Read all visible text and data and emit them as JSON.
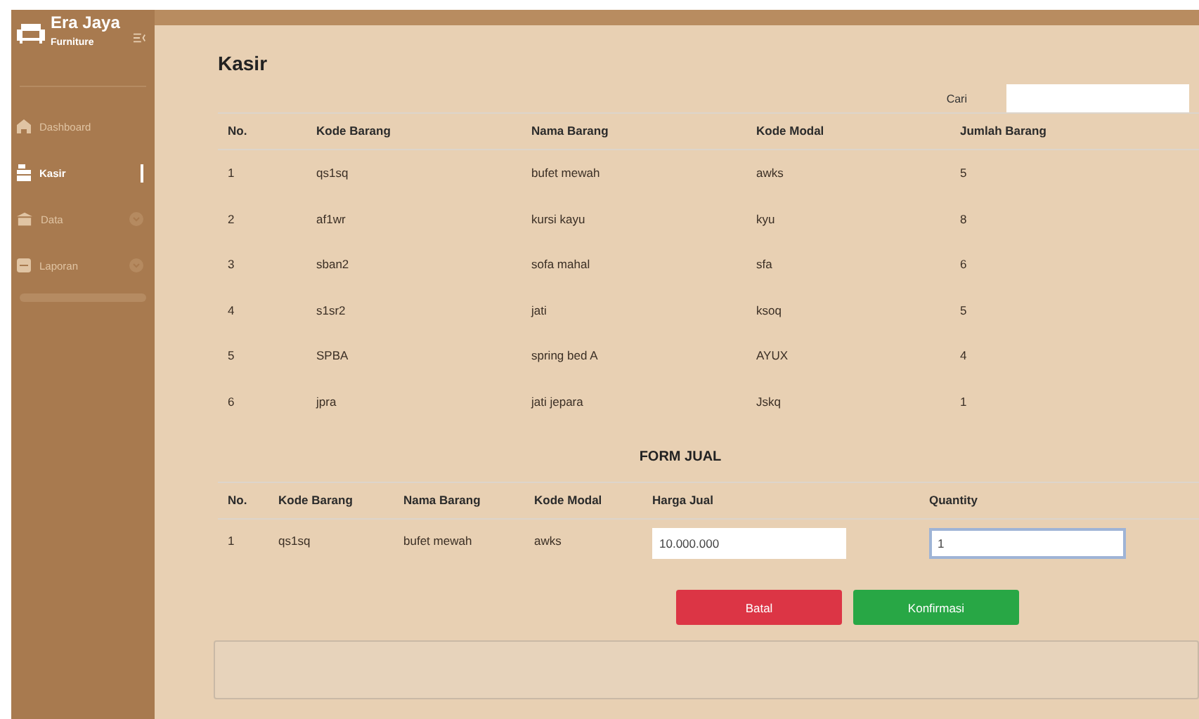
{
  "sidebar": {
    "brand": "Era Jaya",
    "subtitle": "Furniture",
    "items": [
      {
        "label": "Dashboard",
        "kind": "home",
        "selected": false
      },
      {
        "label": "Kasir",
        "kind": "register",
        "selected": true
      },
      {
        "label": "Data",
        "kind": "building",
        "selected": false,
        "expanded": false
      },
      {
        "label": "Laporan",
        "kind": "folder",
        "selected": false,
        "expanded": false
      }
    ]
  },
  "page_title": "Kasir",
  "search": {
    "label": "Cari"
  },
  "table": {
    "columns": [
      "No.",
      "Kode Barang",
      "Nama Barang",
      "Kode Modal",
      "Jumlah Barang"
    ],
    "rows": [
      [
        "1",
        "qs1sq",
        "bufet mewah",
        "awks",
        "5"
      ],
      [
        "2",
        "af1wr",
        "kursi kayu",
        "kyu",
        "8"
      ],
      [
        "3",
        "sban2",
        "sofa mahal",
        "sfa",
        "6"
      ],
      [
        "4",
        "s1sr2",
        "jati",
        "ksoq",
        "5"
      ],
      [
        "5",
        "SPBA",
        "spring bed A",
        "AYUX",
        "4"
      ],
      [
        "6",
        "jpra",
        "jati jepara",
        "Jskq",
        "1"
      ]
    ]
  },
  "form": {
    "title": "FORM JUAL",
    "columns": [
      "No.",
      "Kode Barang",
      "Nama Barang",
      "Kode Modal",
      "Harga Jual",
      "Quantity"
    ],
    "row": {
      "cells": [
        "1",
        "qs1sq",
        "bufet mewah",
        "awks"
      ],
      "harga_jual": "10.000.000",
      "quantity": "1"
    },
    "buttons": [
      {
        "label": "Batal",
        "kind": "danger"
      },
      {
        "label": "Konfirmasi",
        "kind": "success"
      }
    ]
  }
}
